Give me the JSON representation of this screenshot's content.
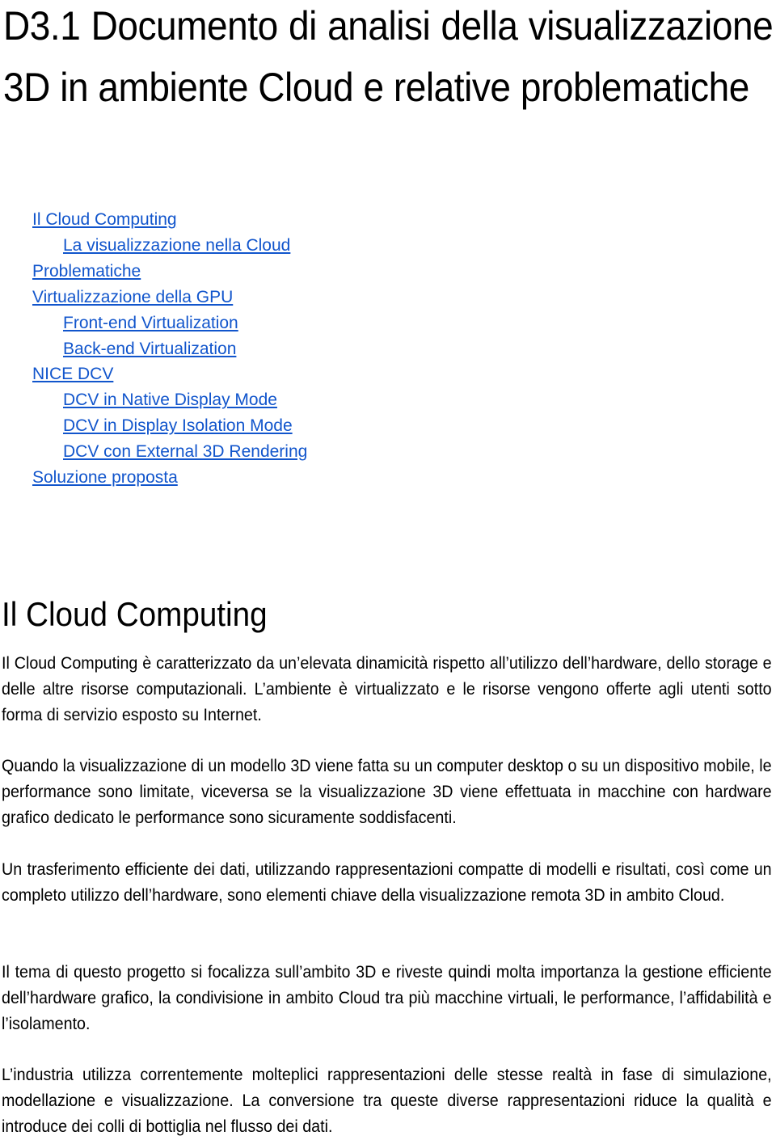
{
  "document": {
    "title": "D3.1 Documento di analisi della visualizzazione 3D in ambiente Cloud e relative problematiche",
    "link_color": "#1155cc",
    "toc": [
      {
        "label": "Il Cloud Computing",
        "level": 1
      },
      {
        "label": "La visualizzazione nella Cloud",
        "level": 2
      },
      {
        "label": "Problematiche",
        "level": 1
      },
      {
        "label": "Virtualizzazione della GPU",
        "level": 1
      },
      {
        "label": "Front-end Virtualization",
        "level": 2
      },
      {
        "label": "Back-end Virtualization",
        "level": 2
      },
      {
        "label": "NICE DCV",
        "level": 1
      },
      {
        "label": "DCV in Native Display Mode",
        "level": 2
      },
      {
        "label": "DCV in Display Isolation Mode",
        "level": 2
      },
      {
        "label": "DCV con External 3D Rendering",
        "level": 2
      },
      {
        "label": "Soluzione proposta",
        "level": 1
      }
    ],
    "section": {
      "heading": "Il Cloud Computing",
      "paragraphs": [
        "Il Cloud Computing è caratterizzato da un’elevata dinamicità rispetto all’utilizzo dell’hardware, dello storage e delle altre risorse computazionali. L’ambiente è virtualizzato e le risorse vengono offerte agli utenti sotto forma di servizio esposto su Internet.",
        "Quando la visualizzazione di un modello 3D viene fatta su un computer desktop o su un dispositivo mobile, le performance sono limitate, viceversa se la visualizzazione 3D viene effettuata in macchine con hardware grafico dedicato le performance sono sicuramente soddisfacenti.",
        "Un trasferimento efficiente dei dati, utilizzando rappresentazioni compatte di modelli e risultati, così come un completo utilizzo dell’hardware, sono elementi chiave della visualizzazione remota 3D in ambito Cloud.",
        "Il tema di questo progetto si focalizza sull’ambito 3D e riveste quindi molta importanza la gestione efficiente dell’hardware grafico, la condivisione in ambito Cloud tra più macchine virtuali, le performance, l’affidabilità e l’isolamento.",
        "L’industria utilizza correntemente molteplici rappresentazioni delle stesse realtà in fase di simulazione, modellazione e visualizzazione. La conversione tra queste diverse rappresentazioni riduce la qualità e introduce dei colli di bottiglia nel flusso dei dati."
      ]
    }
  }
}
